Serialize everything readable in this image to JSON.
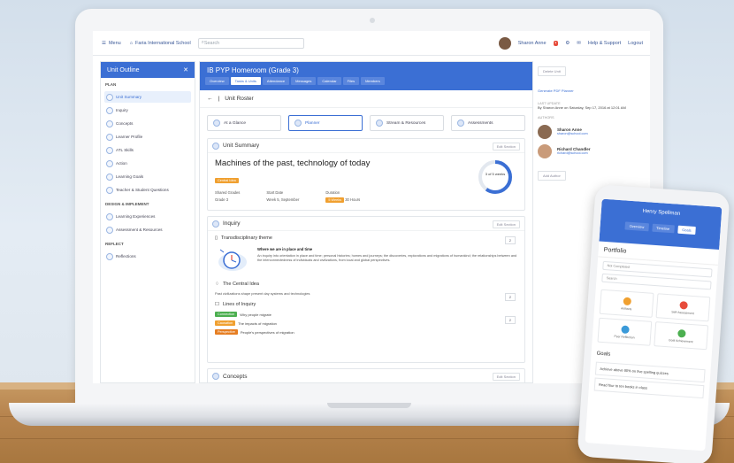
{
  "topbar": {
    "menu": "Menu",
    "school": "Faria International School",
    "search_placeholder": "Search",
    "user": "Sharon Anne",
    "help": "Help & Support",
    "logout": "Logout"
  },
  "sidebar": {
    "title": "Unit Outline",
    "sections": [
      {
        "label": "PLAN",
        "items": [
          "Unit Summary",
          "Inquiry",
          "Concepts",
          "Learner Profile",
          "ATL Skills",
          "Action",
          "Learning Goals",
          "Teacher & Student Questions"
        ]
      },
      {
        "label": "DESIGN & IMPLEMENT",
        "items": [
          "Learning Experiences",
          "Assessment & Resources"
        ]
      },
      {
        "label": "REFLECT",
        "items": [
          "Reflections"
        ]
      }
    ]
  },
  "main": {
    "title": "IB PYP Homeroom (Grade 3)",
    "tabs": [
      "Overview",
      "Tasks & Units",
      "Attendance",
      "Messages",
      "Calendar",
      "Files",
      "Members"
    ],
    "back_label": "Unit Roster",
    "subtabs": [
      "At a Glance",
      "Planner",
      "Stream & Resources",
      "Assessments"
    ],
    "summary": {
      "heading": "Unit Summary",
      "edit": "Edit Section",
      "unit_title": "Machines of the past, technology of today",
      "tag": "Central Idea",
      "grades_label": "Shared Grades",
      "grades_value": "Grade 3",
      "start_label": "Start Date",
      "start_value": "Week 5, September",
      "duration_label": "Duration",
      "duration_tag": "5 Weeks",
      "duration_value": "30 Hours",
      "ring_text": "3 of 5 weeks"
    },
    "inquiry": {
      "heading": "Inquiry",
      "edit": "Edit Section",
      "theme_title": "Transdisciplinary theme",
      "theme_name": "Where we are in place and time",
      "theme_desc": "An inquiry into orientation in place and time; personal histories; homes and journeys; the discoveries, explorations and migrations of humankind; the relationships between and the interconnectedness of individuals and civilizations, from local and global perspectives.",
      "central_title": "The Central Idea",
      "central_text": "Past civilizations shape present day systems and technologies",
      "loi_title": "Lines of Inquiry",
      "lines": [
        {
          "tag": "Connection",
          "color": "#4caf50",
          "text": "Why people migrate"
        },
        {
          "tag": "Causation",
          "color": "#f0a030",
          "text": "The impacts of migration"
        },
        {
          "tag": "Perspective",
          "color": "#e67e22",
          "text": "People's perspectives of migration"
        }
      ],
      "count1": "2",
      "count2": "2",
      "count3": "2"
    },
    "concepts": {
      "heading": "Concepts",
      "edit": "Edit Section"
    }
  },
  "rightpanel": {
    "delete": "Delete Unit",
    "generate": "Generate PDF Planner",
    "last_update_label": "LAST UPDATE",
    "last_update": "By Sharon Anne on Saturday, Sep 17, 2016 at 12:01 AM",
    "authors_label": "AUTHORS",
    "authors": [
      {
        "name": "Sharon Anne",
        "email": "sharon@school.com"
      },
      {
        "name": "Richard Chandler",
        "email": "richard@school.com"
      }
    ],
    "add_author": "Add Author"
  },
  "phone": {
    "user": "Henry Spellman",
    "tabs": [
      "Overview",
      "Timeline",
      "Goals"
    ],
    "title": "Portfolio",
    "input": "Not Completed",
    "search": "Search",
    "cells": [
      {
        "label": "Artifacts",
        "color": "#f0a030"
      },
      {
        "label": "Self-Assessment",
        "color": "#e74c3c"
      },
      {
        "label": "Peer Reflection",
        "color": "#3b9ad9"
      },
      {
        "label": "Goal Achievement",
        "color": "#4caf50"
      }
    ],
    "goals_title": "Goals",
    "goal1": "Achieve above 80% on five spelling quizzes",
    "goal2": "Read four to ten books in class"
  },
  "colors": {
    "brand": "#3b6fd4"
  }
}
